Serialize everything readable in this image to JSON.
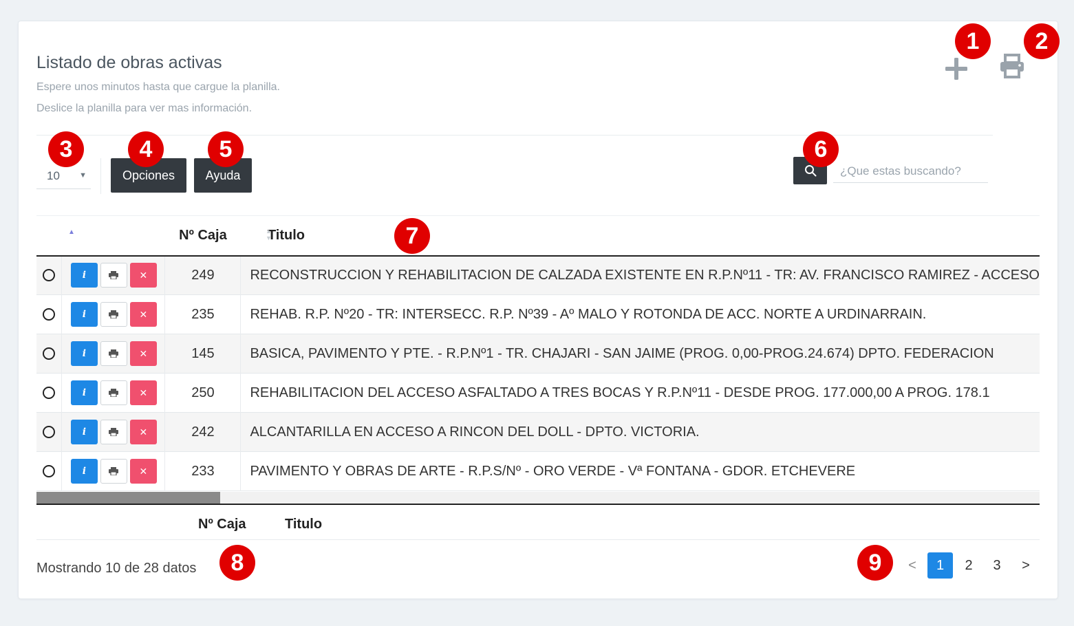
{
  "header": {
    "title": "Listado de obras activas",
    "subtitle_1": "Espere unos minutos hasta que cargue la planilla.",
    "subtitle_2": "Deslice la planilla para ver mas información.",
    "add_icon": "plus-icon",
    "print_icon": "print-icon"
  },
  "toolbar": {
    "page_length": "10",
    "options_label": "Opciones",
    "help_label": "Ayuda",
    "search_icon": "search-icon",
    "search_placeholder": "¿Que estas buscando?"
  },
  "table": {
    "columns": [
      "",
      "",
      "Nº Caja",
      "Titulo"
    ],
    "rows": [
      {
        "caja": "249",
        "titulo": "RECONSTRUCCION Y REHABILITACION DE CALZADA EXISTENTE EN R.P.Nº11 - TR: AV. FRANCISCO RAMIREZ - ACCESO"
      },
      {
        "caja": "235",
        "titulo": "REHAB. R.P. Nº20 - TR: INTERSECC. R.P. Nº39 - Aº MALO Y ROTONDA DE ACC. NORTE A URDINARRAIN."
      },
      {
        "caja": "145",
        "titulo": "BASICA, PAVIMENTO Y PTE. - R.P.Nº1 - TR. CHAJARI - SAN JAIME (PROG. 0,00-PROG.24.674) DPTO. FEDERACION"
      },
      {
        "caja": "250",
        "titulo": "REHABILITACION DEL ACCESO ASFALTADO A TRES BOCAS Y R.P.Nº11 - DESDE PROG. 177.000,00 A PROG. 178.1"
      },
      {
        "caja": "242",
        "titulo": "ALCANTARILLA EN ACCESO A RINCON DEL DOLL - DPTO. VICTORIA."
      },
      {
        "caja": "233",
        "titulo": "PAVIMENTO Y OBRAS DE ARTE - R.P.S/Nº - ORO VERDE - Vª FONTANA - GDOR. ETCHEVERE"
      }
    ],
    "actions": {
      "info_label": "i",
      "info_icon": "info-icon",
      "print_icon": "print-icon",
      "delete_icon": "close-icon"
    },
    "footer_caja": "Nº Caja",
    "footer_titulo": "Titulo"
  },
  "footer": {
    "info": "Mostrando 10 de 28 datos",
    "pagination": {
      "prev": "<",
      "pages": [
        "1",
        "2",
        "3"
      ],
      "active": "1",
      "next": ">"
    }
  },
  "badges": [
    "1",
    "2",
    "3",
    "4",
    "5",
    "6",
    "7",
    "8",
    "9"
  ],
  "colors": {
    "dark_button": "#343a40",
    "info_blue": "#1e88e5",
    "delete_red": "#f0506e",
    "badge_red": "#e00000"
  }
}
